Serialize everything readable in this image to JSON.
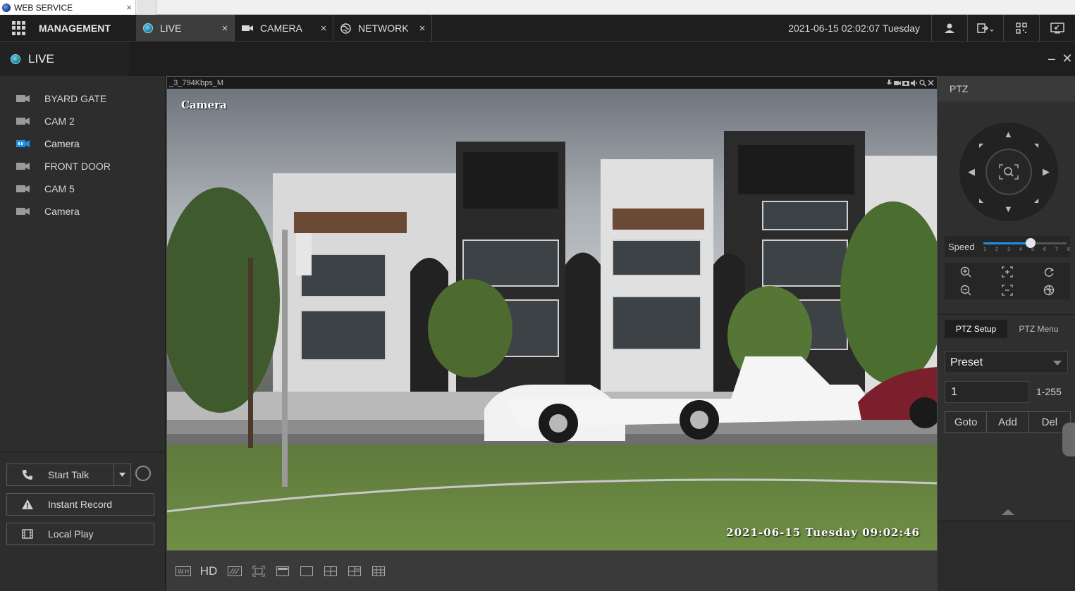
{
  "browser": {
    "tab_title": "WEB SERVICE",
    "tab_close": "×"
  },
  "nav": {
    "management": "MANAGEMENT",
    "tabs": [
      {
        "label": "LIVE",
        "close": "×"
      },
      {
        "label": "CAMERA",
        "close": "×"
      },
      {
        "label": "NETWORK",
        "close": "×"
      }
    ],
    "datetime": "2021-06-15 02:02:07 Tuesday"
  },
  "live": {
    "title": "LIVE",
    "minimize": "–",
    "close": "✕"
  },
  "cameras": [
    {
      "label": "BYARD GATE",
      "active": false
    },
    {
      "label": "CAM 2",
      "active": false
    },
    {
      "label": "Camera",
      "active": true
    },
    {
      "label": "FRONT DOOR",
      "active": false
    },
    {
      "label": "CAM 5",
      "active": false
    },
    {
      "label": "Camera",
      "active": false
    }
  ],
  "sidebar_buttons": {
    "talk": "Start Talk",
    "record": "Instant Record",
    "local_play": "Local Play"
  },
  "video": {
    "stream_info": "_3_794Kbps_M",
    "channel_label": "Camera",
    "osd_time": "2021-06-15 Tuesday 09:02:46"
  },
  "toolbar": {
    "hd": "HD"
  },
  "ptz": {
    "title": "PTZ",
    "speed_label": "Speed",
    "speed_value": 5,
    "speed_ticks": [
      "1",
      "2",
      "3",
      "4",
      "5",
      "6",
      "7",
      "8"
    ],
    "tabs": [
      "PTZ Setup",
      "PTZ Menu"
    ],
    "preset_mode": "Preset",
    "preset_value": "1",
    "preset_range": "1-255",
    "buttons": [
      "Goto",
      "Add",
      "Del"
    ]
  },
  "colors": {
    "accent": "#1e90e0",
    "live_dot": "#0b7a8a"
  }
}
